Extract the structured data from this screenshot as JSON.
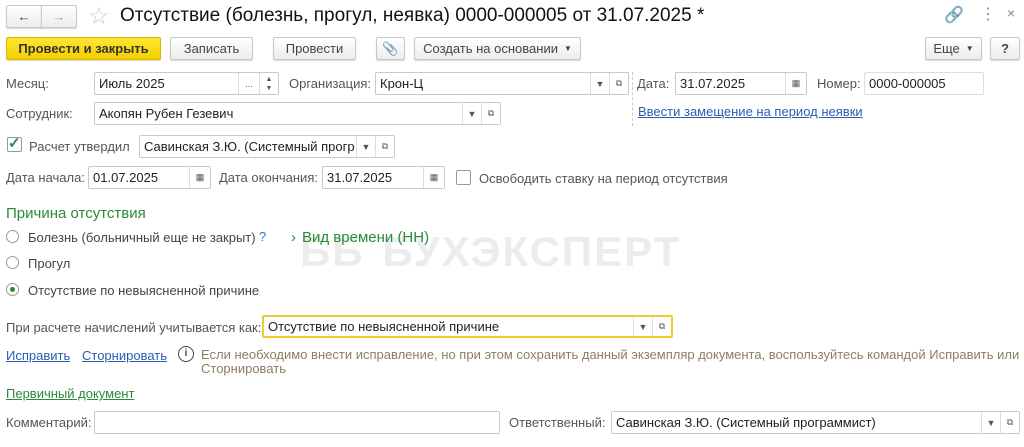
{
  "title": "Отсутствие (болезнь, прогул, неявка) 0000-000005 от 31.07.2025 *",
  "toolbar": {
    "post_close": "Провести и закрыть",
    "save": "Записать",
    "post": "Провести",
    "create_based": "Создать на основании",
    "more": "Еще",
    "help": "?"
  },
  "form": {
    "month_label": "Месяц:",
    "month": "Июль 2025",
    "month_dots": "...",
    "org_label": "Организация:",
    "org": "Крон-Ц",
    "date_label": "Дата:",
    "date": "31.07.2025",
    "number_label": "Номер:",
    "number": "0000-000005",
    "employee_label": "Сотрудник:",
    "employee": "Акопян Рубен Гезевич",
    "replacement_link": "Ввести замещение на период неявки",
    "approved_label": "Расчет утвердил",
    "approved_checked": true,
    "approved_by": "Савинская З.Ю. (Системный прогр",
    "start_label": "Дата начала:",
    "start": "01.07.2025",
    "end_label": "Дата окончания:",
    "end": "31.07.2025",
    "free_rate_label": "Освободить ставку на период отсутствия",
    "free_rate_checked": false,
    "reason_title": "Причина отсутствия",
    "reasons": [
      {
        "label": "Болезнь (больничный еще не закрыт)",
        "selected": false
      },
      {
        "label": "Прогул",
        "selected": false
      },
      {
        "label": "Отсутствие по невыясненной причине",
        "selected": true
      }
    ],
    "help_mark": "?",
    "time_kind": "Вид времени (НН)",
    "watermark": "БУХЭКСПЕРТ",
    "calc_label": "При расчете начислений учитывается как:",
    "calc_value": "Отсутствие по невыясненной причине",
    "fix_link": "Исправить",
    "storno_link": "Сторнировать",
    "info_text_1": "Если необходимо внести исправление, но при этом сохранить данный экземпляр документа, воспользуйтесь командой Исправить или",
    "info_text_2": "Сторнировать",
    "primary_doc_link": "Первичный документ",
    "comment_label": "Комментарий:",
    "comment": "",
    "responsible_label": "Ответственный:",
    "responsible": "Савинская З.Ю. (Системный программист)"
  }
}
